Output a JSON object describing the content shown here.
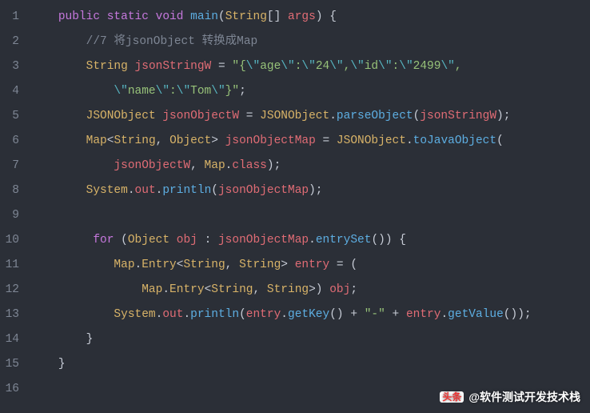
{
  "watermark": {
    "badge_text": "头条",
    "handle": "@软件测试开发技术栈"
  },
  "code": {
    "lines": [
      {
        "n": "1",
        "indent": 1,
        "tokens": [
          {
            "t": "public",
            "c": "kw"
          },
          {
            "t": " "
          },
          {
            "t": "static",
            "c": "kw"
          },
          {
            "t": " "
          },
          {
            "t": "void",
            "c": "kw"
          },
          {
            "t": " "
          },
          {
            "t": "main",
            "c": "method"
          },
          {
            "t": "(",
            "c": "punc"
          },
          {
            "t": "String",
            "c": "type"
          },
          {
            "t": "[] ",
            "c": "punc"
          },
          {
            "t": "args",
            "c": "pname"
          },
          {
            "t": ") {",
            "c": "punc"
          }
        ]
      },
      {
        "n": "2",
        "indent": 2,
        "tokens": [
          {
            "t": "//7 将jsonObject 转换成Map",
            "c": "cmt"
          }
        ]
      },
      {
        "n": "3",
        "indent": 2,
        "tokens": [
          {
            "t": "String",
            "c": "type"
          },
          {
            "t": " "
          },
          {
            "t": "jsonStringW",
            "c": "pname"
          },
          {
            "t": " = ",
            "c": "punc"
          },
          {
            "t": "\"{",
            "c": "str"
          },
          {
            "t": "\\\"",
            "c": "esc"
          },
          {
            "t": "age",
            "c": "str"
          },
          {
            "t": "\\\"",
            "c": "esc"
          },
          {
            "t": ":",
            "c": "str"
          },
          {
            "t": "\\\"",
            "c": "esc"
          },
          {
            "t": "24",
            "c": "str"
          },
          {
            "t": "\\\"",
            "c": "esc"
          },
          {
            "t": ",",
            "c": "str"
          },
          {
            "t": "\\\"",
            "c": "esc"
          },
          {
            "t": "id",
            "c": "str"
          },
          {
            "t": "\\\"",
            "c": "esc"
          },
          {
            "t": ":",
            "c": "str"
          },
          {
            "t": "\\\"",
            "c": "esc"
          },
          {
            "t": "2499",
            "c": "str"
          },
          {
            "t": "\\\"",
            "c": "esc"
          },
          {
            "t": ",",
            "c": "str"
          }
        ]
      },
      {
        "n": "4",
        "indent": 3,
        "tokens": [
          {
            "t": "\\\"",
            "c": "esc"
          },
          {
            "t": "name",
            "c": "str"
          },
          {
            "t": "\\\"",
            "c": "esc"
          },
          {
            "t": ":",
            "c": "str"
          },
          {
            "t": "\\\"",
            "c": "esc"
          },
          {
            "t": "Tom",
            "c": "str"
          },
          {
            "t": "\\\"",
            "c": "esc"
          },
          {
            "t": "}\"",
            "c": "str"
          },
          {
            "t": ";",
            "c": "punc"
          }
        ]
      },
      {
        "n": "5",
        "indent": 2,
        "tokens": [
          {
            "t": "JSONObject",
            "c": "type"
          },
          {
            "t": " "
          },
          {
            "t": "jsonObjectW",
            "c": "pname"
          },
          {
            "t": " = ",
            "c": "punc"
          },
          {
            "t": "JSONObject",
            "c": "type"
          },
          {
            "t": ".",
            "c": "punc"
          },
          {
            "t": "parseObject",
            "c": "method"
          },
          {
            "t": "(",
            "c": "punc"
          },
          {
            "t": "jsonStringW",
            "c": "pname"
          },
          {
            "t": ");",
            "c": "punc"
          }
        ]
      },
      {
        "n": "6",
        "indent": 2,
        "tokens": [
          {
            "t": "Map",
            "c": "type"
          },
          {
            "t": "<",
            "c": "punc"
          },
          {
            "t": "String",
            "c": "type"
          },
          {
            "t": ", ",
            "c": "punc"
          },
          {
            "t": "Object",
            "c": "type"
          },
          {
            "t": "> ",
            "c": "punc"
          },
          {
            "t": "jsonObjectMap",
            "c": "pname"
          },
          {
            "t": " = ",
            "c": "punc"
          },
          {
            "t": "JSONObject",
            "c": "type"
          },
          {
            "t": ".",
            "c": "punc"
          },
          {
            "t": "toJavaObject",
            "c": "method"
          },
          {
            "t": "(",
            "c": "punc"
          }
        ]
      },
      {
        "n": "7",
        "indent": 3,
        "tokens": [
          {
            "t": "jsonObjectW",
            "c": "pname"
          },
          {
            "t": ", ",
            "c": "punc"
          },
          {
            "t": "Map",
            "c": "type"
          },
          {
            "t": ".",
            "c": "punc"
          },
          {
            "t": "class",
            "c": "prop"
          },
          {
            "t": ");",
            "c": "punc"
          }
        ]
      },
      {
        "n": "8",
        "indent": 2,
        "tokens": [
          {
            "t": "System",
            "c": "type"
          },
          {
            "t": ".",
            "c": "punc"
          },
          {
            "t": "out",
            "c": "prop"
          },
          {
            "t": ".",
            "c": "punc"
          },
          {
            "t": "println",
            "c": "method"
          },
          {
            "t": "(",
            "c": "punc"
          },
          {
            "t": "jsonObjectMap",
            "c": "pname"
          },
          {
            "t": ");",
            "c": "punc"
          }
        ]
      },
      {
        "n": "9",
        "indent": 0,
        "tokens": []
      },
      {
        "n": "10",
        "indent": 2,
        "tokens": [
          {
            "t": " "
          },
          {
            "t": "for",
            "c": "kw"
          },
          {
            "t": " (",
            "c": "punc"
          },
          {
            "t": "Object",
            "c": "type"
          },
          {
            "t": " "
          },
          {
            "t": "obj",
            "c": "pname"
          },
          {
            "t": " : ",
            "c": "punc"
          },
          {
            "t": "jsonObjectMap",
            "c": "pname"
          },
          {
            "t": ".",
            "c": "punc"
          },
          {
            "t": "entrySet",
            "c": "method"
          },
          {
            "t": "()) {",
            "c": "punc"
          }
        ]
      },
      {
        "n": "11",
        "indent": 3,
        "tokens": [
          {
            "t": "Map",
            "c": "type"
          },
          {
            "t": ".",
            "c": "punc"
          },
          {
            "t": "Entry",
            "c": "type"
          },
          {
            "t": "<",
            "c": "punc"
          },
          {
            "t": "String",
            "c": "type"
          },
          {
            "t": ", ",
            "c": "punc"
          },
          {
            "t": "String",
            "c": "type"
          },
          {
            "t": "> ",
            "c": "punc"
          },
          {
            "t": "entry",
            "c": "pname"
          },
          {
            "t": " = (",
            "c": "punc"
          }
        ]
      },
      {
        "n": "12",
        "indent": 4,
        "tokens": [
          {
            "t": "Map",
            "c": "type"
          },
          {
            "t": ".",
            "c": "punc"
          },
          {
            "t": "Entry",
            "c": "type"
          },
          {
            "t": "<",
            "c": "punc"
          },
          {
            "t": "String",
            "c": "type"
          },
          {
            "t": ", ",
            "c": "punc"
          },
          {
            "t": "String",
            "c": "type"
          },
          {
            "t": ">) ",
            "c": "punc"
          },
          {
            "t": "obj",
            "c": "pname"
          },
          {
            "t": ";",
            "c": "punc"
          }
        ]
      },
      {
        "n": "13",
        "indent": 3,
        "tokens": [
          {
            "t": "System",
            "c": "type"
          },
          {
            "t": ".",
            "c": "punc"
          },
          {
            "t": "out",
            "c": "prop"
          },
          {
            "t": ".",
            "c": "punc"
          },
          {
            "t": "println",
            "c": "method"
          },
          {
            "t": "(",
            "c": "punc"
          },
          {
            "t": "entry",
            "c": "pname"
          },
          {
            "t": ".",
            "c": "punc"
          },
          {
            "t": "getKey",
            "c": "method"
          },
          {
            "t": "() + ",
            "c": "punc"
          },
          {
            "t": "\"-\"",
            "c": "str"
          },
          {
            "t": " + ",
            "c": "punc"
          },
          {
            "t": "entry",
            "c": "pname"
          },
          {
            "t": ".",
            "c": "punc"
          },
          {
            "t": "getValue",
            "c": "method"
          },
          {
            "t": "());",
            "c": "punc"
          }
        ]
      },
      {
        "n": "14",
        "indent": 2,
        "tokens": [
          {
            "t": "}",
            "c": "punc"
          }
        ]
      },
      {
        "n": "15",
        "indent": 1,
        "tokens": [
          {
            "t": "}",
            "c": "punc"
          }
        ]
      },
      {
        "n": "16",
        "indent": 0,
        "tokens": []
      }
    ]
  }
}
